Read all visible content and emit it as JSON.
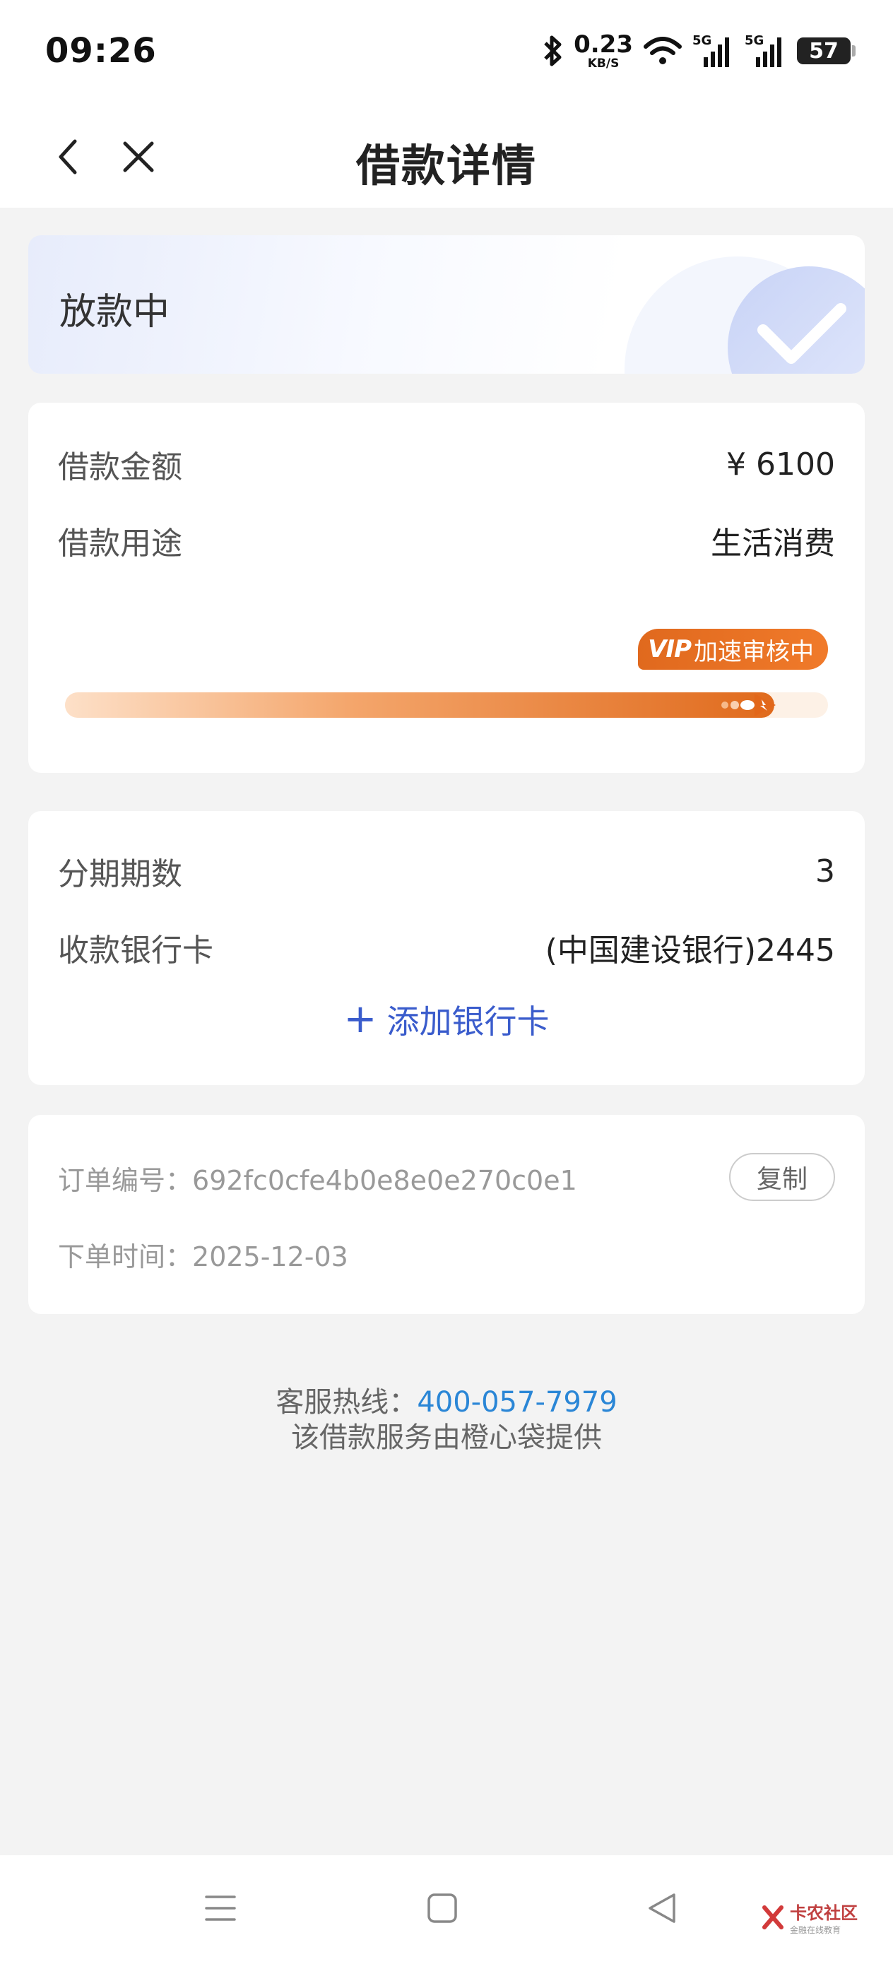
{
  "status_bar": {
    "time": "09:26",
    "net_speed_value": "0.23",
    "net_speed_unit": "KB/S",
    "signal_1": "5G",
    "signal_2": "5G",
    "battery": "57",
    "icons": [
      "bluetooth-icon",
      "wifi-icon",
      "signal-icon",
      "battery-icon"
    ]
  },
  "nav": {
    "title": "借款详情"
  },
  "status_card": {
    "status": "放款中"
  },
  "loan": {
    "amount_label": "借款金额",
    "amount_value": "¥ 6100",
    "purpose_label": "借款用途",
    "purpose_value": "生活消费",
    "vip_badge_vip": "VIP",
    "vip_badge_text": "加速审核中",
    "progress": 0.93
  },
  "installment": {
    "periods_label": "分期期数",
    "periods_value": "3",
    "bank_label": "收款银行卡",
    "bank_value": "(中国建设银行)2445",
    "add_card_plus": "+",
    "add_card_label": "添加银行卡"
  },
  "order": {
    "number_label": "订单编号：",
    "number_value": "692fc0cfe4b0e8e0e270c0e1",
    "copy_label": "复制",
    "time_label": "下单时间：",
    "time_value": "2025-12-03"
  },
  "footer": {
    "hotline_label": "客服热线：",
    "hotline_number": "400-057-7979",
    "provider": "该借款服务由橙心袋提供"
  },
  "watermark": {
    "text": "卡农社区",
    "sub": "金融在线教育"
  },
  "colors": {
    "accent_blue": "#3a5ccc",
    "link_blue": "#2a86d6",
    "orange": "#e06a1c"
  }
}
